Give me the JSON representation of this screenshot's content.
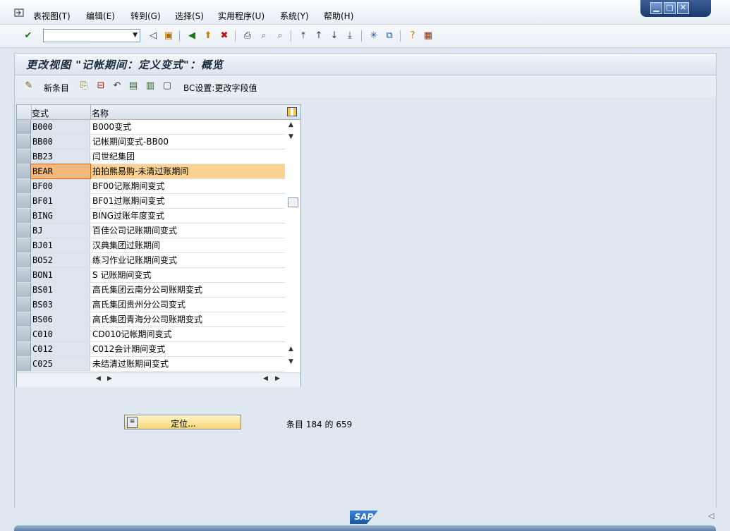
{
  "menu": {
    "items": [
      "表视图(T)",
      "编辑(E)",
      "转到(G)",
      "选择(S)",
      "实用程序(U)",
      "系统(Y)",
      "帮助(H)"
    ]
  },
  "toolbar": {
    "command_field": ""
  },
  "screen": {
    "title": "更改视图 \"记帐期间：定义变式\"：概览"
  },
  "app_toolbar": {
    "new_entries": "新条目",
    "bc_set": "BC设置:更改字段值"
  },
  "table": {
    "columns": [
      "变式",
      "名称"
    ],
    "rows": [
      {
        "code": "B000",
        "name": "B000变式"
      },
      {
        "code": "BB00",
        "name": "记帐期间变式-BB00"
      },
      {
        "code": "BB23",
        "name": "闫世纪集团"
      },
      {
        "code": "BEAR",
        "name": "拍拍熊易购-未清过账期间"
      },
      {
        "code": "BF00",
        "name": "BF00记账期间变式"
      },
      {
        "code": "BF01",
        "name": "BF01过账期间变式"
      },
      {
        "code": "BING",
        "name": "BING过账年度变式"
      },
      {
        "code": "BJ",
        "name": "百佳公司记账期间变式"
      },
      {
        "code": "BJ01",
        "name": "汉典集团过账期间"
      },
      {
        "code": "BO52",
        "name": "练习作业记账期间变式"
      },
      {
        "code": "BON1",
        "name": "S 记账期间变式"
      },
      {
        "code": "BS01",
        "name": "高氏集团云南分公司账期变式"
      },
      {
        "code": "BS03",
        "name": "高氏集团贵州分公司变式"
      },
      {
        "code": "BS06",
        "name": "高氏集团青海分公司账期变式"
      },
      {
        "code": "C010",
        "name": "CD010记帐期间变式"
      },
      {
        "code": "C012",
        "name": "C012会计期间变式"
      },
      {
        "code": "C025",
        "name": "未结清过账期间变式"
      }
    ],
    "highlighted_row": 3
  },
  "position_button": {
    "label": "定位..."
  },
  "status": {
    "entries_text": "条目 184 的 659"
  },
  "footer": {
    "logo": "SAP"
  }
}
